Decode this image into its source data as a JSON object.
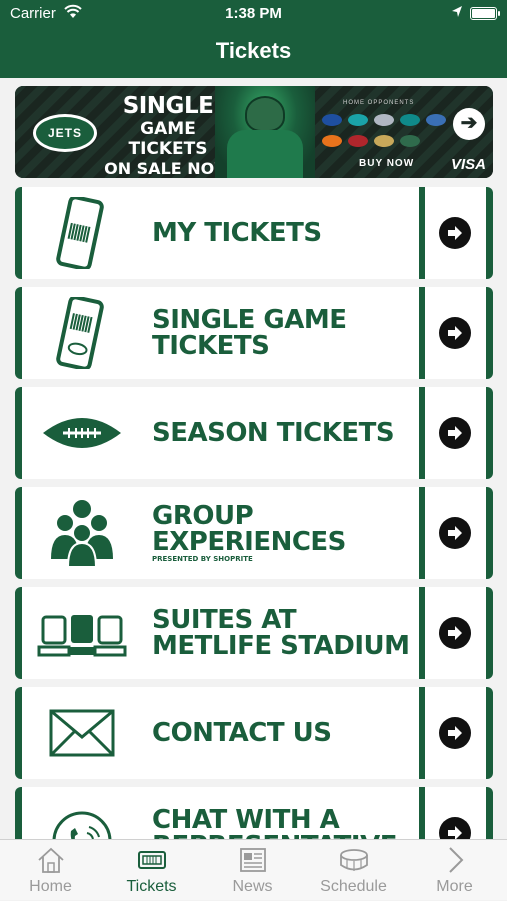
{
  "status_bar": {
    "carrier": "Carrier",
    "time": "1:38 PM"
  },
  "nav": {
    "title": "Tickets"
  },
  "banner": {
    "logo_text": "JETS",
    "line1": "SINGLE",
    "line2": "GAME TICKETS",
    "line3": "ON SALE NOW",
    "opponents_label": "HOME OPPONENTS",
    "buy_label": "BUY NOW",
    "sponsor": "VISA"
  },
  "menu": [
    {
      "label": "MY TICKETS",
      "sub": ""
    },
    {
      "label": "SINGLE GAME TICKETS",
      "sub": ""
    },
    {
      "label": "SEASON TICKETS",
      "sub": ""
    },
    {
      "label": "GROUP EXPERIENCES",
      "sub": "PRESENTED BY SHOPRITE"
    },
    {
      "label": "SUITES AT METLIFE STADIUM",
      "sub": ""
    },
    {
      "label": "CONTACT US",
      "sub": ""
    },
    {
      "label": "CHAT WITH A REPRESENTATIVE",
      "sub": ""
    }
  ],
  "tabs": [
    {
      "label": "Home",
      "icon": "home-icon"
    },
    {
      "label": "Tickets",
      "icon": "ticket-icon"
    },
    {
      "label": "News",
      "icon": "newspaper-icon"
    },
    {
      "label": "Schedule",
      "icon": "stadium-icon"
    },
    {
      "label": "More",
      "icon": "chevron-right-icon"
    }
  ],
  "colors": {
    "brand_green": "#1a5e3c",
    "tab_inactive": "#9a9a9a"
  }
}
